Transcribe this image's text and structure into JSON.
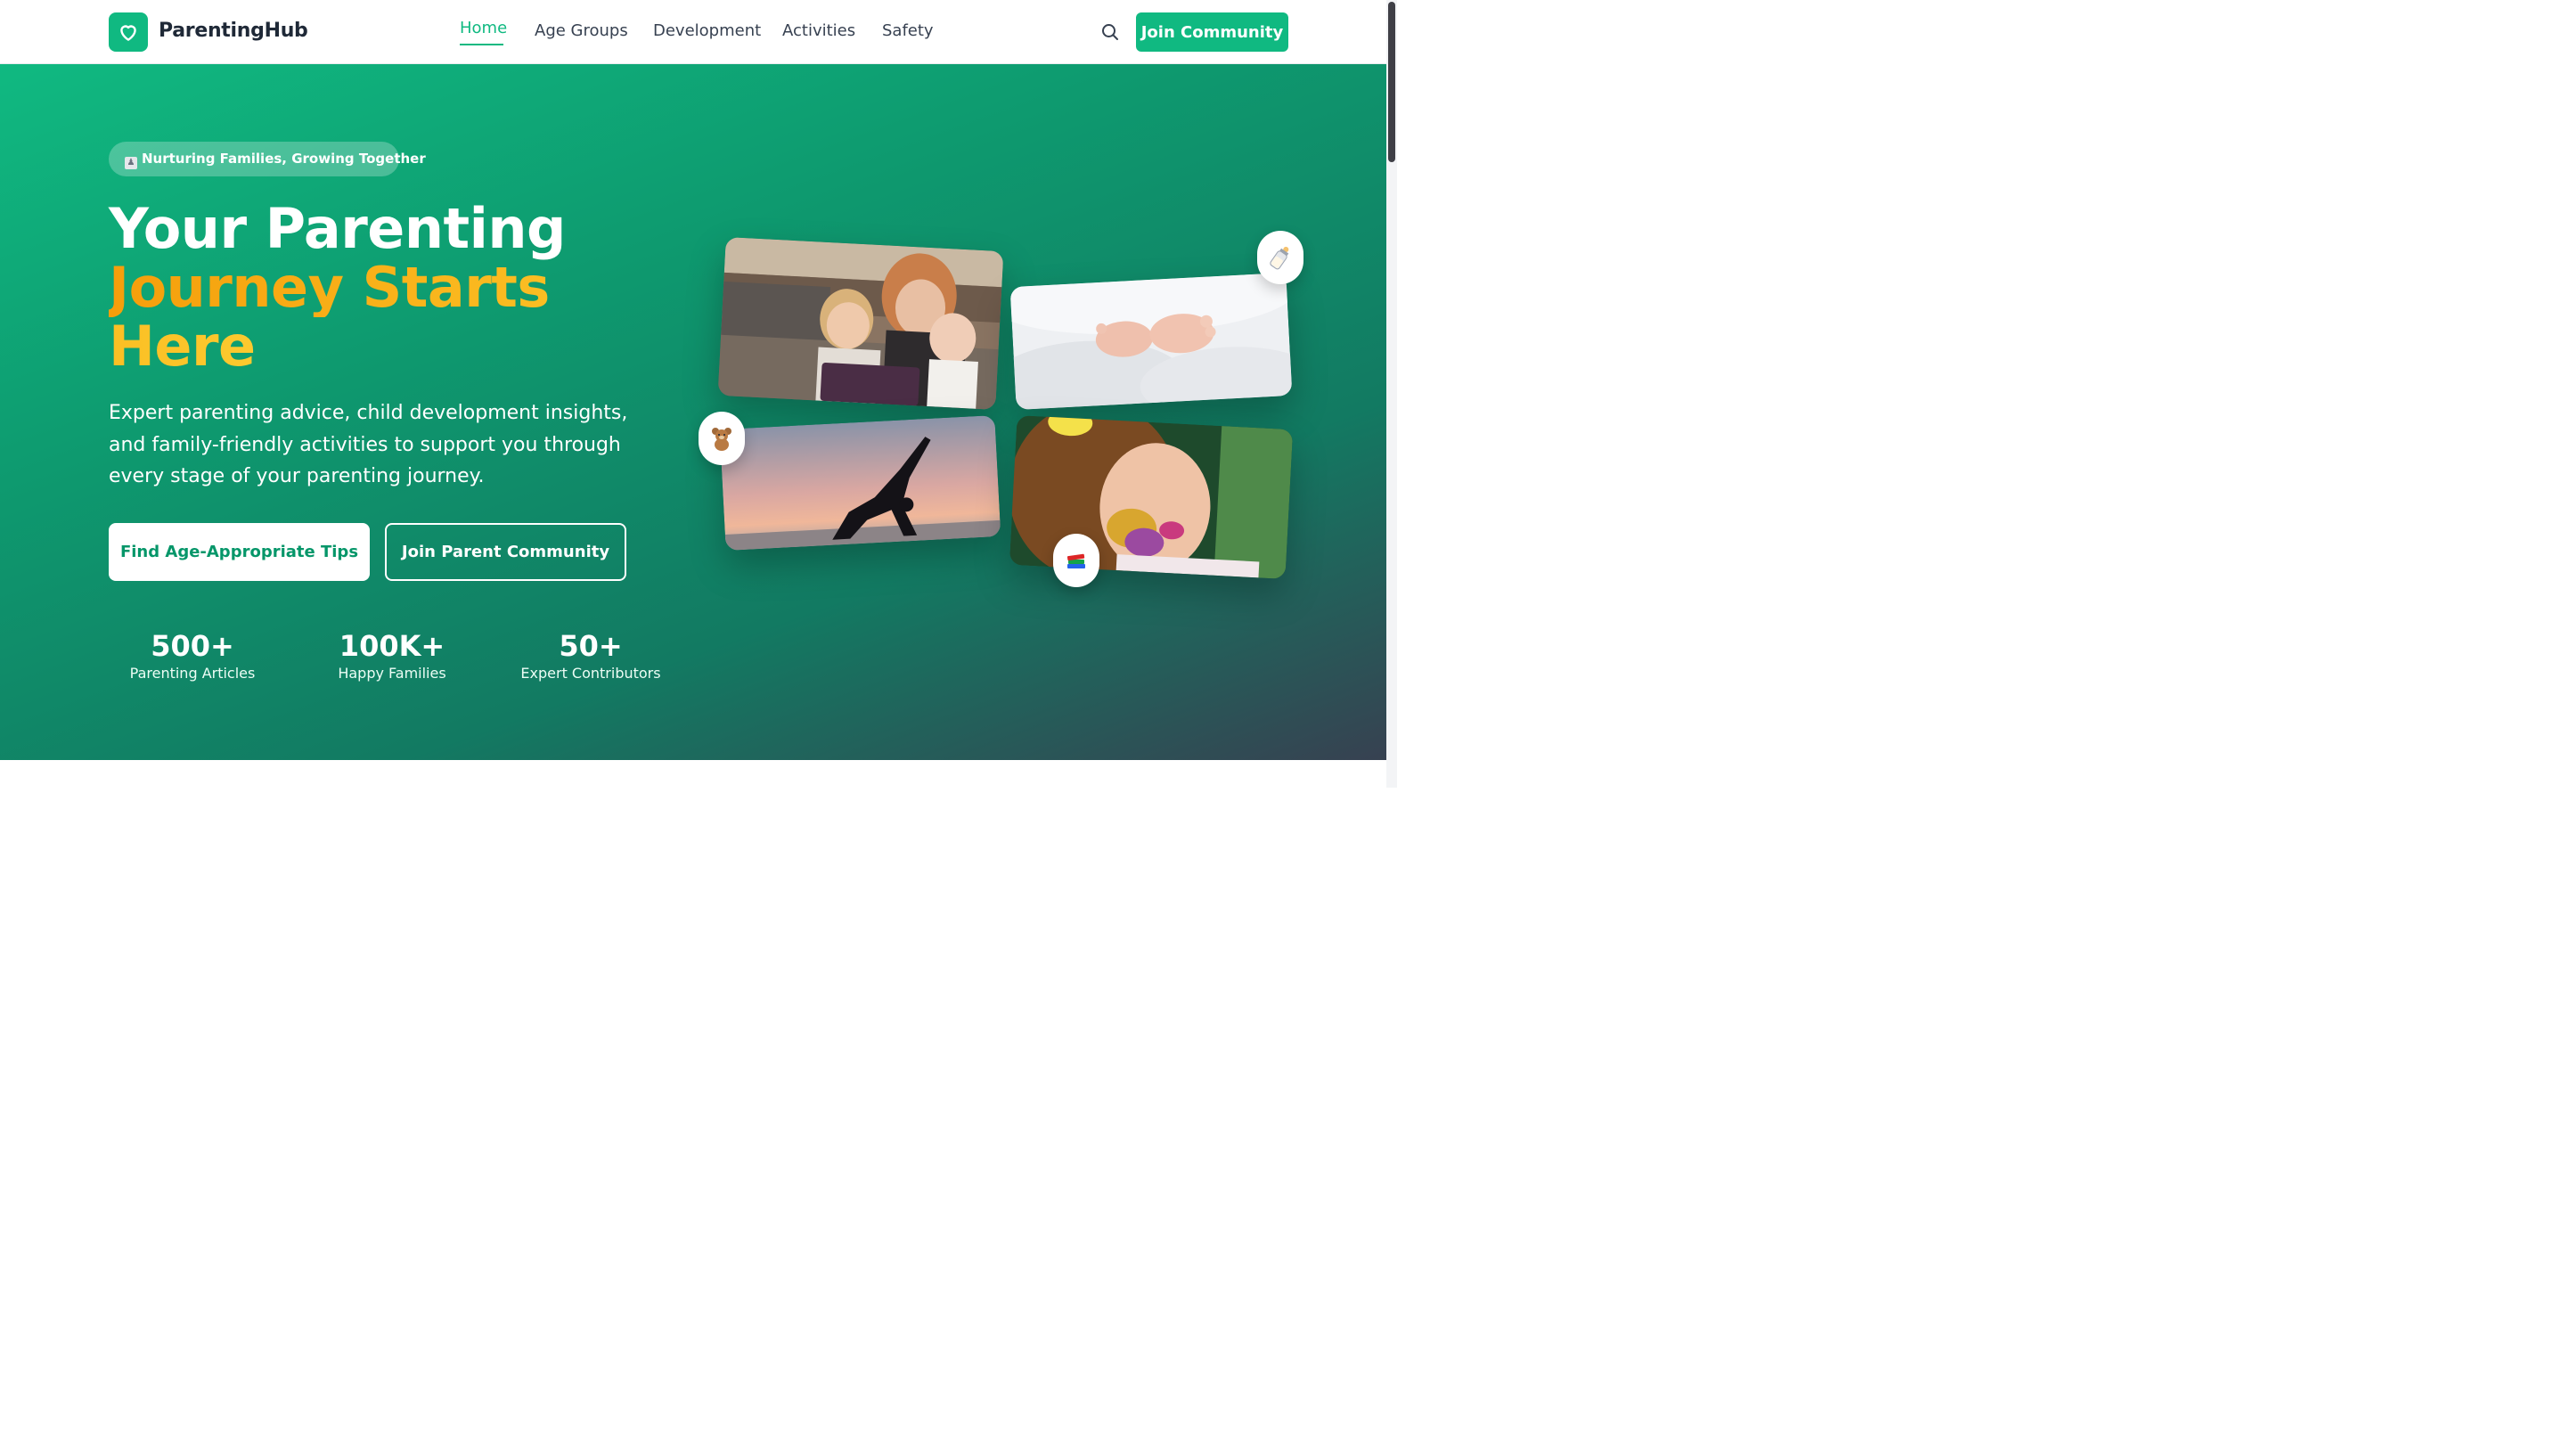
{
  "brand": {
    "name": "ParentingHub",
    "accent": "#10b981",
    "logo_icon": "heart-icon"
  },
  "nav": {
    "links": [
      {
        "label": "Home",
        "active": true
      },
      {
        "label": "Age Groups"
      },
      {
        "label": "Development"
      },
      {
        "label": "Activities"
      },
      {
        "label": "Safety"
      }
    ],
    "search_icon": "search-icon",
    "cta_label": "Join Community"
  },
  "hero": {
    "tagline": "Nurturing Families, Growing Together",
    "tagline_icon": "family-icon",
    "headline_line1": "Your Parenting",
    "headline_line2": "Journey Starts",
    "headline_line3": "Here",
    "lead": "Expert parenting advice, child development insights, and family-friendly activities to support you through every stage of your parenting journey.",
    "primary_button": "Find Age-Appropriate Tips",
    "secondary_button": "Join Parent Community",
    "stats": [
      {
        "value": "500+",
        "label": "Parenting Articles"
      },
      {
        "value": "100K+",
        "label": "Happy Families"
      },
      {
        "value": "50+",
        "label": "Expert Contributors"
      }
    ],
    "gallery": {
      "photos": [
        "mother-with-children-photo",
        "baby-feet-photo",
        "yoga-silhouette-photo",
        "painted-child-photo"
      ],
      "badges": [
        "baby-bottle-icon",
        "teddy-bear-icon",
        "books-icon"
      ]
    }
  }
}
